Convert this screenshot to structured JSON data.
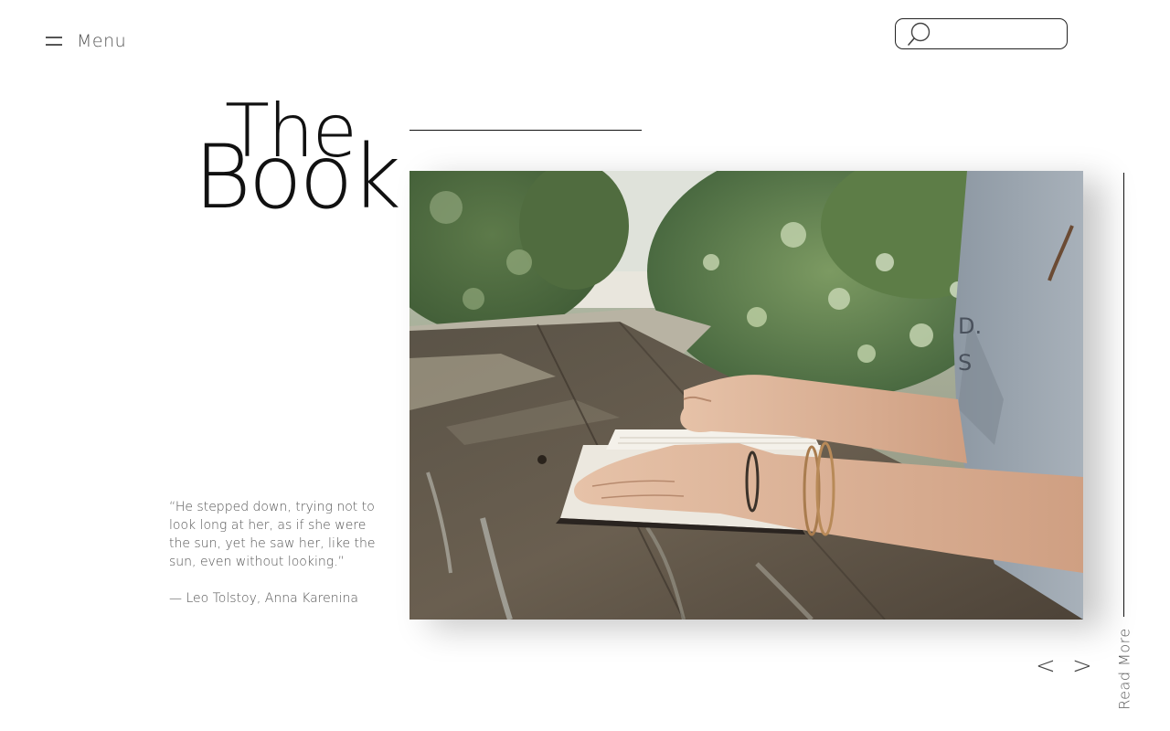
{
  "header": {
    "menu_label": "Menu",
    "menu_icon": "hamburger-icon",
    "search": {
      "icon": "search-icon",
      "value": "",
      "placeholder": ""
    }
  },
  "hero": {
    "title_line1": "The",
    "title_line2": "Book",
    "image_description_icon": "photo-image",
    "read_more_label": "Read More"
  },
  "quote": {
    "text": "“He stepped down, trying not to look long at her, as if she were the sun, yet he saw her, like the sun, even without looking.”",
    "attribution": "— Leo Tolstoy, Anna Karenina"
  },
  "navigation": {
    "prev_label": "<",
    "next_label": ">"
  },
  "colors": {
    "background": "#ffffff",
    "text": "#555555",
    "title": "#111111",
    "line": "#111111"
  }
}
